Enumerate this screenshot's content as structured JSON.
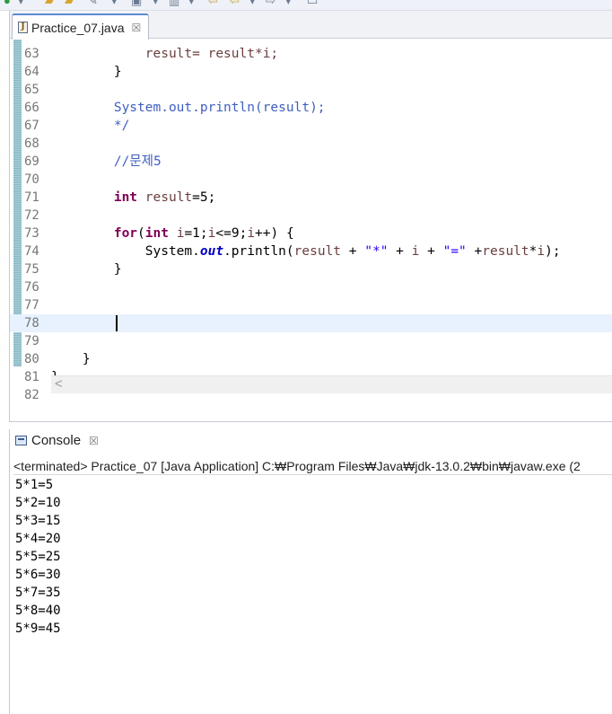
{
  "editor": {
    "tab_label": "Practice_07.java",
    "tab_close": "☒",
    "current_line": 78,
    "lines": [
      {
        "n": "63",
        "tokens": [
          {
            "t": "            result= result*i;",
            "c": "var"
          }
        ]
      },
      {
        "n": "64",
        "tokens": [
          {
            "t": "        }",
            "c": ""
          }
        ]
      },
      {
        "n": "65",
        "tokens": []
      },
      {
        "n": "66",
        "tokens": [
          {
            "t": "        System.out.println(result);",
            "c": "cm"
          }
        ]
      },
      {
        "n": "67",
        "tokens": [
          {
            "t": "        */",
            "c": "cm"
          }
        ]
      },
      {
        "n": "68",
        "tokens": []
      },
      {
        "n": "69",
        "tokens": [
          {
            "t": "        //문제5",
            "c": "cm"
          }
        ]
      },
      {
        "n": "70",
        "tokens": []
      },
      {
        "n": "71",
        "tokens": [
          {
            "t": "        ",
            "c": ""
          },
          {
            "t": "int",
            "c": "kw"
          },
          {
            "t": " result",
            "c": "var"
          },
          {
            "t": "=5;",
            "c": ""
          }
        ]
      },
      {
        "n": "72",
        "tokens": []
      },
      {
        "n": "73",
        "tokens": [
          {
            "t": "        ",
            "c": ""
          },
          {
            "t": "for",
            "c": "kw"
          },
          {
            "t": "(",
            "c": ""
          },
          {
            "t": "int",
            "c": "kw"
          },
          {
            "t": " i",
            "c": "var"
          },
          {
            "t": "=1;",
            "c": ""
          },
          {
            "t": "i",
            "c": "var"
          },
          {
            "t": "<=9;",
            "c": ""
          },
          {
            "t": "i",
            "c": "var"
          },
          {
            "t": "++) {",
            "c": ""
          }
        ]
      },
      {
        "n": "74",
        "tokens": [
          {
            "t": "            System.",
            "c": ""
          },
          {
            "t": "out",
            "c": "fld"
          },
          {
            "t": ".println(",
            "c": ""
          },
          {
            "t": "result",
            "c": "var"
          },
          {
            "t": " + ",
            "c": ""
          },
          {
            "t": "\"*\"",
            "c": "str"
          },
          {
            "t": " + ",
            "c": ""
          },
          {
            "t": "i",
            "c": "var"
          },
          {
            "t": " + ",
            "c": ""
          },
          {
            "t": "\"=\"",
            "c": "str"
          },
          {
            "t": " +",
            "c": ""
          },
          {
            "t": "result",
            "c": "var"
          },
          {
            "t": "*",
            "c": ""
          },
          {
            "t": "i",
            "c": "var"
          },
          {
            "t": ");",
            "c": ""
          }
        ]
      },
      {
        "n": "75",
        "tokens": [
          {
            "t": "        }",
            "c": ""
          }
        ]
      },
      {
        "n": "76",
        "tokens": []
      },
      {
        "n": "77",
        "tokens": []
      },
      {
        "n": "78",
        "tokens": []
      },
      {
        "n": "79",
        "tokens": []
      },
      {
        "n": "80",
        "tokens": [
          {
            "t": "    }",
            "c": ""
          }
        ]
      },
      {
        "n": "81",
        "tokens": [
          {
            "t": "}",
            "c": ""
          }
        ]
      },
      {
        "n": "82",
        "tokens": []
      }
    ]
  },
  "console": {
    "tab_label": "Console",
    "tab_close": "☒",
    "status": "<terminated> Practice_07 [Java Application] C:₩Program Files₩Java₩jdk-13.0.2₩bin₩javaw.exe  (2",
    "output": [
      "5*1=5",
      "5*2=10",
      "5*3=15",
      "5*4=20",
      "5*5=25",
      "5*6=30",
      "5*7=35",
      "5*8=40",
      "5*9=45"
    ]
  },
  "icons": {
    "java_file": "J",
    "hscroll_left": "<"
  },
  "colors": {
    "keyword": "#7f0055",
    "comment": "#3f5fbf",
    "string": "#2a00ff",
    "field": "#0000c0",
    "variable": "#6a3e3e",
    "current_line": "#e8f2fe"
  }
}
